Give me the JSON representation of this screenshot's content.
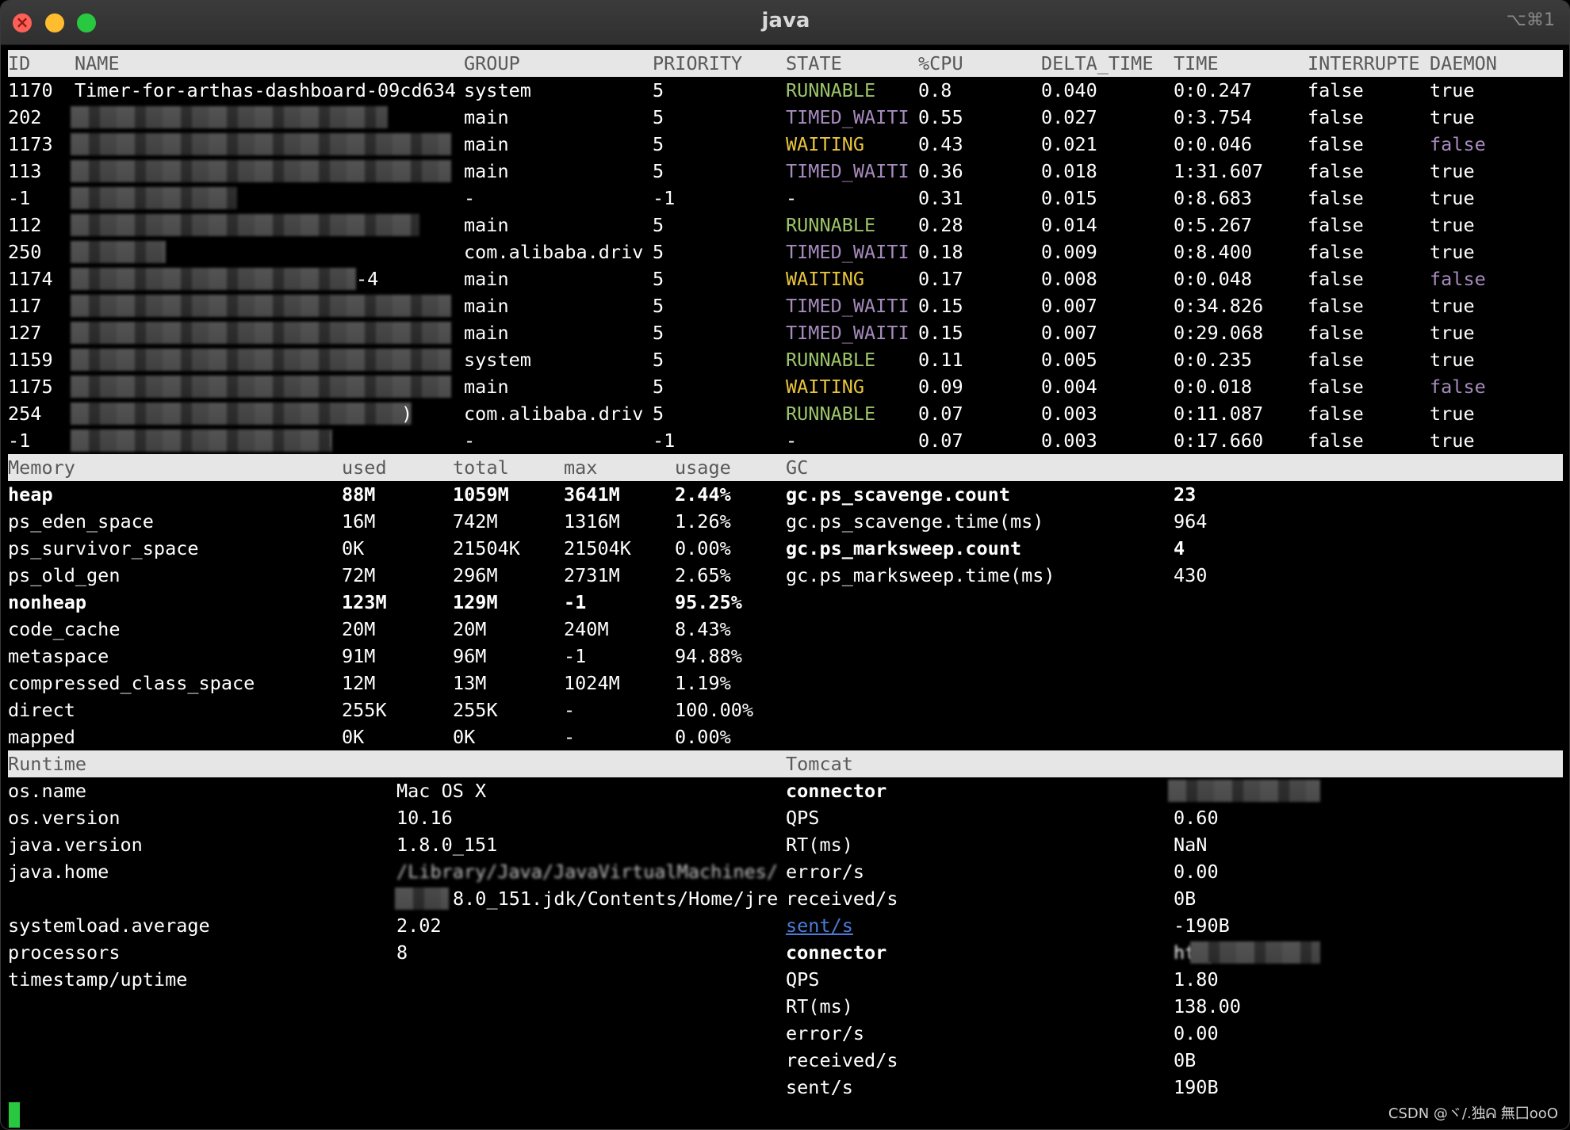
{
  "window": {
    "title": "java",
    "shortcut": "⌥⌘1"
  },
  "threads": {
    "headers": [
      "ID",
      "NAME",
      "GROUP",
      "PRIORITY",
      "STATE",
      "%CPU",
      "DELTA_TIME",
      "TIME",
      "INTERRUPTE",
      "DAEMON"
    ],
    "rows": [
      {
        "id": "1170",
        "name": "Timer-for-arthas-dashboard-09cd634",
        "group": "system",
        "priority": "5",
        "state": "RUNNABLE",
        "cpu": "0.8",
        "delta": "0.040",
        "time": "0:0.247",
        "interrupted": "false",
        "daemon": "true"
      },
      {
        "id": "202",
        "name": "",
        "group": "main",
        "priority": "5",
        "state": "TIMED_WAITI",
        "cpu": "0.55",
        "delta": "0.027",
        "time": "0:3.754",
        "interrupted": "false",
        "daemon": "true"
      },
      {
        "id": "1173",
        "name": "",
        "group": "main",
        "priority": "5",
        "state": "WAITING",
        "cpu": "0.43",
        "delta": "0.021",
        "time": "0:0.046",
        "interrupted": "false",
        "daemon": "false"
      },
      {
        "id": "113",
        "name": "",
        "group": "main",
        "priority": "5",
        "state": "TIMED_WAITI",
        "cpu": "0.36",
        "delta": "0.018",
        "time": "1:31.607",
        "interrupted": "false",
        "daemon": "true"
      },
      {
        "id": "-1",
        "name": "",
        "group": "-",
        "priority": "-1",
        "state": "-",
        "cpu": "0.31",
        "delta": "0.015",
        "time": "0:8.683",
        "interrupted": "false",
        "daemon": "true"
      },
      {
        "id": "112",
        "name": "",
        "group": "main",
        "priority": "5",
        "state": "RUNNABLE",
        "cpu": "0.28",
        "delta": "0.014",
        "time": "0:5.267",
        "interrupted": "false",
        "daemon": "true"
      },
      {
        "id": "250",
        "name": "",
        "group": "com.alibaba.driv",
        "priority": "5",
        "state": "TIMED_WAITI",
        "cpu": "0.18",
        "delta": "0.009",
        "time": "0:8.400",
        "interrupted": "false",
        "daemon": "true"
      },
      {
        "id": "1174",
        "name": "-4",
        "group": "main",
        "priority": "5",
        "state": "WAITING",
        "cpu": "0.17",
        "delta": "0.008",
        "time": "0:0.048",
        "interrupted": "false",
        "daemon": "false"
      },
      {
        "id": "117",
        "name": "",
        "group": "main",
        "priority": "5",
        "state": "TIMED_WAITI",
        "cpu": "0.15",
        "delta": "0.007",
        "time": "0:34.826",
        "interrupted": "false",
        "daemon": "true"
      },
      {
        "id": "127",
        "name": "",
        "group": "main",
        "priority": "5",
        "state": "TIMED_WAITI",
        "cpu": "0.15",
        "delta": "0.007",
        "time": "0:29.068",
        "interrupted": "false",
        "daemon": "true"
      },
      {
        "id": "1159",
        "name": "",
        "group": "system",
        "priority": "5",
        "state": "RUNNABLE",
        "cpu": "0.11",
        "delta": "0.005",
        "time": "0:0.235",
        "interrupted": "false",
        "daemon": "true"
      },
      {
        "id": "1175",
        "name": "",
        "group": "main",
        "priority": "5",
        "state": "WAITING",
        "cpu": "0.09",
        "delta": "0.004",
        "time": "0:0.018",
        "interrupted": "false",
        "daemon": "false"
      },
      {
        "id": "254",
        "name": ")",
        "group": "com.alibaba.driv",
        "priority": "5",
        "state": "RUNNABLE",
        "cpu": "0.07",
        "delta": "0.003",
        "time": "0:11.087",
        "interrupted": "false",
        "daemon": "true"
      },
      {
        "id": "-1",
        "name": "VM Periodic Task Thread",
        "group": "-",
        "priority": "-1",
        "state": "-",
        "cpu": "0.07",
        "delta": "0.003",
        "time": "0:17.660",
        "interrupted": "false",
        "daemon": "true"
      }
    ]
  },
  "memory": {
    "headers": [
      "Memory",
      "used",
      "total",
      "max",
      "usage"
    ],
    "rows": [
      {
        "name": "heap",
        "used": "88M",
        "total": "1059M",
        "max": "3641M",
        "usage": "2.44%",
        "bold": true
      },
      {
        "name": "ps_eden_space",
        "used": "16M",
        "total": "742M",
        "max": "1316M",
        "usage": "1.26%",
        "bold": false
      },
      {
        "name": "ps_survivor_space",
        "used": "0K",
        "total": "21504K",
        "max": "21504K",
        "usage": "0.00%",
        "bold": false
      },
      {
        "name": "ps_old_gen",
        "used": "72M",
        "total": "296M",
        "max": "2731M",
        "usage": "2.65%",
        "bold": false
      },
      {
        "name": "nonheap",
        "used": "123M",
        "total": "129M",
        "max": "-1",
        "usage": "95.25%",
        "bold": true
      },
      {
        "name": "code_cache",
        "used": "20M",
        "total": "20M",
        "max": "240M",
        "usage": "8.43%",
        "bold": false
      },
      {
        "name": "metaspace",
        "used": "91M",
        "total": "96M",
        "max": "-1",
        "usage": "94.88%",
        "bold": false
      },
      {
        "name": "compressed_class_space",
        "used": "12M",
        "total": "13M",
        "max": "1024M",
        "usage": "1.19%",
        "bold": false
      },
      {
        "name": "direct",
        "used": "255K",
        "total": "255K",
        "max": "-",
        "usage": "100.00%",
        "bold": false
      },
      {
        "name": "mapped",
        "used": "0K",
        "total": "0K",
        "max": "-",
        "usage": "0.00%",
        "bold": false
      }
    ]
  },
  "gc": {
    "header": "GC",
    "rows": [
      {
        "name": "gc.ps_scavenge.count",
        "value": "23",
        "bold": true
      },
      {
        "name": "gc.ps_scavenge.time(ms)",
        "value": "964",
        "bold": false
      },
      {
        "name": "gc.ps_marksweep.count",
        "value": "4",
        "bold": true
      },
      {
        "name": "gc.ps_marksweep.time(ms)",
        "value": "430",
        "bold": false
      }
    ]
  },
  "runtime": {
    "header": "Runtime",
    "rows": [
      {
        "key": "os.name",
        "value": "Mac OS X"
      },
      {
        "key": "os.version",
        "value": "10.16"
      },
      {
        "key": "java.version",
        "value": "1.8.0_151"
      },
      {
        "key": "java.home",
        "value": "/Library/Java/JavaVirtualMachines/"
      },
      {
        "key": "",
        "value": "8.0_151.jdk/Contents/Home/jre"
      },
      {
        "key": "systemload.average",
        "value": "2.02"
      },
      {
        "key": "processors",
        "value": "8"
      },
      {
        "key": "timestamp/uptime",
        "value": ""
      }
    ]
  },
  "tomcat": {
    "header": "Tomcat",
    "rows": [
      {
        "key": "connector",
        "value": "",
        "bold": true,
        "link": false
      },
      {
        "key": "QPS",
        "value": "0.60",
        "bold": false,
        "link": false
      },
      {
        "key": "RT(ms)",
        "value": "NaN",
        "bold": false,
        "link": false
      },
      {
        "key": "error/s",
        "value": "0.00",
        "bold": false,
        "link": false
      },
      {
        "key": "received/s",
        "value": "0B",
        "bold": false,
        "link": false
      },
      {
        "key": "sent/s",
        "value": "-190B",
        "bold": false,
        "link": true
      },
      {
        "key": "connector",
        "value": "http-nio-7001",
        "bold": true,
        "link": false
      },
      {
        "key": "QPS",
        "value": "1.80",
        "bold": false,
        "link": false
      },
      {
        "key": "RT(ms)",
        "value": "138.00",
        "bold": false,
        "link": false
      },
      {
        "key": "error/s",
        "value": "0.00",
        "bold": false,
        "link": false
      },
      {
        "key": "received/s",
        "value": "0B",
        "bold": false,
        "link": false
      },
      {
        "key": "sent/s",
        "value": "190B",
        "bold": false,
        "link": false
      }
    ]
  },
  "watermark": "CSDN @ヾ/.独ᕱ 無囗ooO",
  "colors": {
    "runnable": "#9cc56a",
    "timed_waiting": "#a68bbd",
    "waiting": "#e8c53c",
    "header_bg": "#e6e6e6",
    "cursor": "#28c840"
  }
}
